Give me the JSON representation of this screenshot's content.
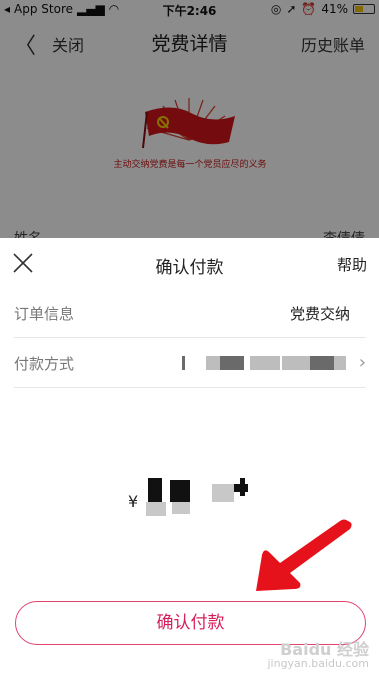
{
  "status_bar": {
    "carrier": "App Store",
    "time": "下午2:46",
    "battery": "41%"
  },
  "nav": {
    "close_label": "关闭",
    "title": "党费详情",
    "history_label": "历史账单"
  },
  "banner": {
    "slogan": "主动交纳党费是每一个党员应尽的义务"
  },
  "background_row": {
    "label": "姓名",
    "value": "李倩倩"
  },
  "sheet": {
    "title": "确认付款",
    "help_label": "帮助",
    "rows": [
      {
        "label": "订单信息",
        "value": "党费交纳"
      },
      {
        "label": "付款方式",
        "value": ""
      }
    ],
    "amount_currency": "¥",
    "confirm_label": "确认付款"
  },
  "watermark": {
    "brand": "Baidu 经验",
    "url": "jingyan.baidu.com"
  },
  "colors": {
    "accent": "#d81e5a",
    "accent_border": "#e0456e",
    "banner_red": "#c41a1a",
    "arrow_red": "#e6121b"
  }
}
